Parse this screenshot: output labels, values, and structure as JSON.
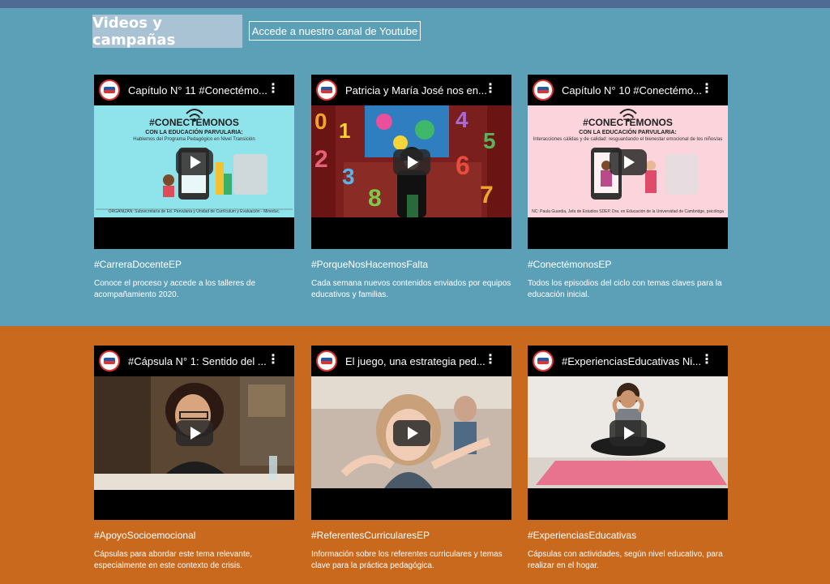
{
  "header": {
    "title": "Videos y campañas",
    "youtube_link": "Accede a nuestro canal de Youtube"
  },
  "cards": [
    {
      "video_title": "Capítulo N° 11 #Conectémo...",
      "thumbnail": {
        "heading": "#CONECTÉMONOS",
        "subheading": "CON LA EDUCACIÓN PARVULARIA:",
        "caption": "Hablemos del Programa Pedagógico en Nivel Transición",
        "footer": "ORGANIZAN: Subsecretaría de Ed. Parvularia y Unidad de Currículum y Evaluación - Mineduc."
      },
      "hashtag": "#CarreraDocenteEP",
      "description": "Conoce el proceso y accede a los talleres de acompañamiento 2020."
    },
    {
      "video_title": "Patricia y María José nos en...",
      "hashtag": "#PorqueNosHacemosFalta",
      "description": "Cada semana nuevos contenidos enviados por equipos educativos y familias.",
      "numbers": [
        "0",
        "1",
        "2",
        "3",
        "8",
        "4",
        "5",
        "6",
        "7"
      ]
    },
    {
      "video_title": "Capítulo N° 10 #Conectémo...",
      "thumbnail": {
        "heading": "#CONECTÉMONOS",
        "subheading": "CON LA EDUCACIÓN PARVULARIA:",
        "caption": "Interacciones cálidas y de calidad: resguardando el bienestar emocional de los niños/as",
        "footer": "NC: Paula Guardia, Jefa de Estudios SDEP, Dra. en Educación de la Universidad de Cambridge, psicóloga"
      },
      "hashtag": "#ConectémonosEP",
      "description": "Todos los episodios del ciclo con temas claves para la educación inicial."
    },
    {
      "video_title": "#Cápsula N° 1: Sentido del ...",
      "hashtag": "#ApoyoSocioemocional",
      "description": "Cápsulas para abordar este tema relevante, especialmente en este contexto de crisis."
    },
    {
      "video_title": "El juego, una estrategia ped...",
      "hashtag": "#ReferentesCurricularesEP",
      "description": "Información sobre los referentes curriculares y temas clave para la práctica pedagógica."
    },
    {
      "video_title": "#ExperienciasEducativas Ni...",
      "hashtag": "#ExperienciasEducativas",
      "description": "Cápsulas con actividades, según nivel educativo, para realizar en el hogar."
    }
  ],
  "colors": {
    "top_bar": "#4f6b94",
    "blue_section": "#5ca0b8",
    "orange_section": "#c9691e",
    "title_box": "#a9c2d4"
  },
  "icons": [
    "logo-icon",
    "more-vert-icon",
    "play-icon",
    "wifi-icon"
  ]
}
